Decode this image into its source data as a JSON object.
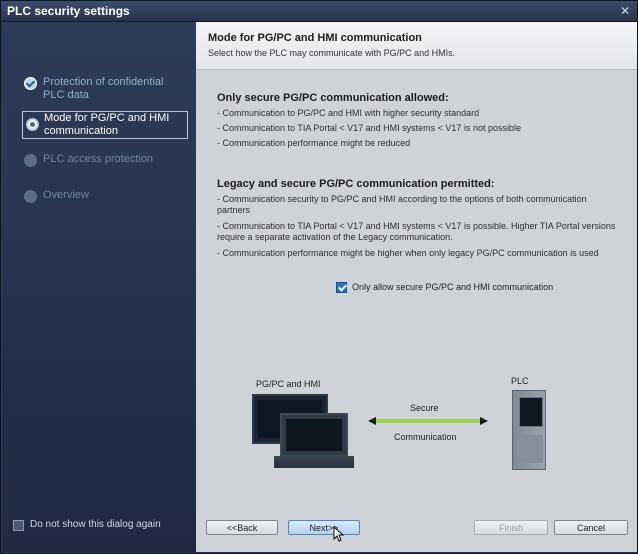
{
  "window": {
    "title": "PLC security settings"
  },
  "sidebar": {
    "steps": [
      {
        "label": "Protection of confidential PLC data",
        "state": "done"
      },
      {
        "label": "Mode for PG/PC and HMI communication",
        "state": "active"
      },
      {
        "label": "PLC access protection",
        "state": "pending"
      },
      {
        "label": "Overview",
        "state": "pending"
      }
    ],
    "dont_show_label": "Do not show this dialog again",
    "dont_show_checked": false
  },
  "header": {
    "title": "Mode for PG/PC and HMI communication",
    "subtitle": "Select how the PLC may communicate with PG/PC and HMIs."
  },
  "secure_section": {
    "title": "Only secure PG/PC communication allowed:",
    "lines": [
      "- Communication to PG/PC and HMI with higher security standard",
      "- Communication to TIA Portal < V17 and HMI systems < V17 is not possible",
      "- Communication performance might be reduced"
    ]
  },
  "legacy_section": {
    "title": "Legacy and secure PG/PC communication permitted:",
    "lines": [
      "- Communication security to PG/PC and HMI according to the options of both communication partners",
      "- Communication to TIA Portal < V17 and HMI systems < V17 is possible. Higher TIA Portal versions require a separate activation of the Legacy communication.",
      "- Communication performance might be higher when only legacy PG/PC communication is used"
    ]
  },
  "option": {
    "label": "Only allow secure PG/PC and HMI communication",
    "checked": true
  },
  "diagram": {
    "pc_label": "PG/PC and HMI",
    "plc_label": "PLC",
    "secure_label": "Secure",
    "communication_label": "Communication"
  },
  "buttons": {
    "back": "<<Back",
    "next": "Next>>",
    "finish": "Finish",
    "cancel": "Cancel"
  },
  "colors": {
    "sidebar": "#2c3a52",
    "accent": "#1f73c9",
    "connector": "#9bd34a"
  }
}
